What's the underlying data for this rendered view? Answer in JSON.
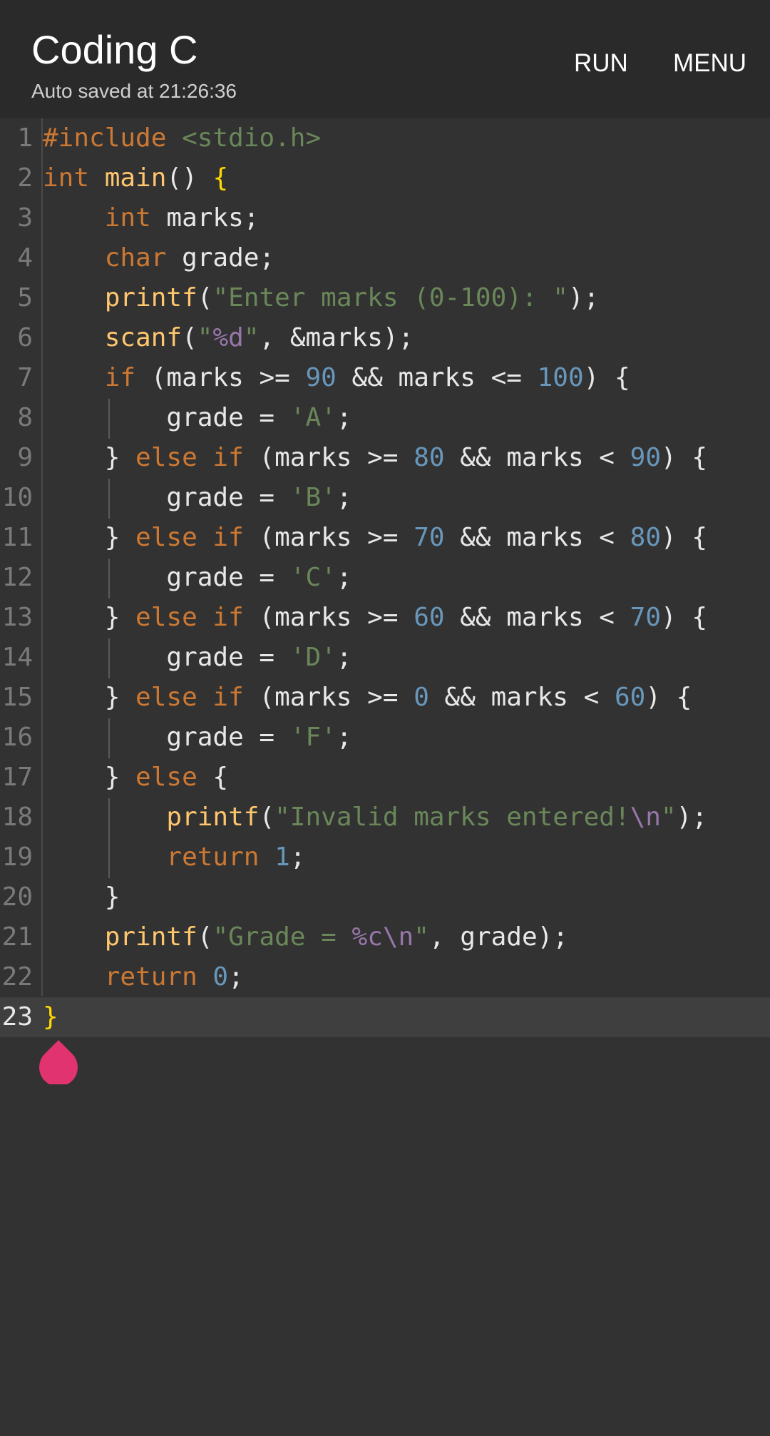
{
  "header": {
    "title": "Coding C",
    "subtitle": "Auto saved at 21:26:36",
    "run_label": "RUN",
    "menu_label": "MENU"
  },
  "editor": {
    "current_line": 23,
    "line_numbers": [
      "1",
      "2",
      "3",
      "4",
      "5",
      "6",
      "7",
      "8",
      "9",
      "10",
      "11",
      "12",
      "13",
      "14",
      "15",
      "16",
      "17",
      "18",
      "19",
      "20",
      "21",
      "22",
      "23"
    ],
    "lines": [
      [
        [
          "kw",
          "#include "
        ],
        [
          "str",
          "<stdio.h>"
        ]
      ],
      [
        [
          "kw",
          "int "
        ],
        [
          "fn",
          "main"
        ],
        [
          "pl",
          "() "
        ],
        [
          "brace",
          "{"
        ]
      ],
      [
        [
          "pl",
          "    "
        ],
        [
          "kw",
          "int "
        ],
        [
          "pl",
          "marks;"
        ]
      ],
      [
        [
          "pl",
          "    "
        ],
        [
          "kw",
          "char "
        ],
        [
          "pl",
          "grade;"
        ]
      ],
      [
        [
          "pl",
          "    "
        ],
        [
          "fn",
          "printf"
        ],
        [
          "pl",
          "("
        ],
        [
          "str",
          "\"Enter marks (0-100): \""
        ],
        [
          "pl",
          ");"
        ]
      ],
      [
        [
          "pl",
          "    "
        ],
        [
          "fn",
          "scanf"
        ],
        [
          "pl",
          "("
        ],
        [
          "str",
          "\""
        ],
        [
          "esc",
          "%d"
        ],
        [
          "str",
          "\""
        ],
        [
          "pl",
          ", &marks);"
        ]
      ],
      [
        [
          "pl",
          "    "
        ],
        [
          "kw",
          "if "
        ],
        [
          "pl",
          "(marks >= "
        ],
        [
          "num",
          "90"
        ],
        [
          "pl",
          " && marks <= "
        ],
        [
          "num",
          "100"
        ],
        [
          "pl",
          ") {"
        ]
      ],
      [
        [
          "pl",
          "        grade = "
        ],
        [
          "str",
          "'A'"
        ],
        [
          "pl",
          ";"
        ]
      ],
      [
        [
          "pl",
          "    } "
        ],
        [
          "kw",
          "else if "
        ],
        [
          "pl",
          "(marks >= "
        ],
        [
          "num",
          "80"
        ],
        [
          "pl",
          " && marks < "
        ],
        [
          "num",
          "90"
        ],
        [
          "pl",
          ") {"
        ]
      ],
      [
        [
          "pl",
          "        grade = "
        ],
        [
          "str",
          "'B'"
        ],
        [
          "pl",
          ";"
        ]
      ],
      [
        [
          "pl",
          "    } "
        ],
        [
          "kw",
          "else if "
        ],
        [
          "pl",
          "(marks >= "
        ],
        [
          "num",
          "70"
        ],
        [
          "pl",
          " && marks < "
        ],
        [
          "num",
          "80"
        ],
        [
          "pl",
          ") {"
        ]
      ],
      [
        [
          "pl",
          "        grade = "
        ],
        [
          "str",
          "'C'"
        ],
        [
          "pl",
          ";"
        ]
      ],
      [
        [
          "pl",
          "    } "
        ],
        [
          "kw",
          "else if "
        ],
        [
          "pl",
          "(marks >= "
        ],
        [
          "num",
          "60"
        ],
        [
          "pl",
          " && marks < "
        ],
        [
          "num",
          "70"
        ],
        [
          "pl",
          ") {"
        ]
      ],
      [
        [
          "pl",
          "        grade = "
        ],
        [
          "str",
          "'D'"
        ],
        [
          "pl",
          ";"
        ]
      ],
      [
        [
          "pl",
          "    } "
        ],
        [
          "kw",
          "else if "
        ],
        [
          "pl",
          "(marks >= "
        ],
        [
          "num",
          "0"
        ],
        [
          "pl",
          " && marks < "
        ],
        [
          "num",
          "60"
        ],
        [
          "pl",
          ") {"
        ]
      ],
      [
        [
          "pl",
          "        grade = "
        ],
        [
          "str",
          "'F'"
        ],
        [
          "pl",
          ";"
        ]
      ],
      [
        [
          "pl",
          "    } "
        ],
        [
          "kw",
          "else "
        ],
        [
          "pl",
          "{"
        ]
      ],
      [
        [
          "pl",
          "        "
        ],
        [
          "fn",
          "printf"
        ],
        [
          "pl",
          "("
        ],
        [
          "str",
          "\"Invalid marks entered!"
        ],
        [
          "esc",
          "\\n"
        ],
        [
          "str",
          "\""
        ],
        [
          "pl",
          ");"
        ]
      ],
      [
        [
          "pl",
          "        "
        ],
        [
          "kw",
          "return "
        ],
        [
          "num",
          "1"
        ],
        [
          "pl",
          ";"
        ]
      ],
      [
        [
          "pl",
          "    }"
        ]
      ],
      [
        [
          "pl",
          "    "
        ],
        [
          "fn",
          "printf"
        ],
        [
          "pl",
          "("
        ],
        [
          "str",
          "\"Grade = "
        ],
        [
          "esc",
          "%c\\n"
        ],
        [
          "str",
          "\""
        ],
        [
          "pl",
          ", grade);"
        ]
      ],
      [
        [
          "pl",
          "    "
        ],
        [
          "kw",
          "return "
        ],
        [
          "num",
          "0"
        ],
        [
          "pl",
          ";"
        ]
      ],
      [
        [
          "brace",
          "}"
        ]
      ]
    ]
  },
  "colors": {
    "background": "#323232",
    "appbar": "#2a2a2a",
    "keyword": "#cc7832",
    "function": "#ffc66d",
    "string": "#6a8759",
    "number": "#6897bb",
    "escape": "#9876aa",
    "brace": "#ffd700",
    "cursor_handle": "#e0336f"
  },
  "icons": {
    "cursor_handle": "text-cursor-handle-icon"
  }
}
